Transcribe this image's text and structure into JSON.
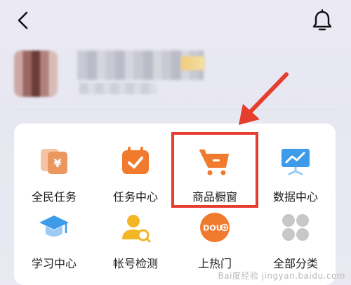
{
  "header": {
    "back_icon": "back-arrow-icon",
    "notification_icon": "bell-icon"
  },
  "profile": {
    "avatar": "blurred-avatar",
    "name": "",
    "subtitle": ""
  },
  "tools": [
    {
      "label": "全民任务",
      "icon": "coin-cards-icon"
    },
    {
      "label": "任务中心",
      "icon": "calendar-check-icon"
    },
    {
      "label": "商品橱窗",
      "icon": "shopping-cart-icon"
    },
    {
      "label": "数据中心",
      "icon": "presentation-chart-icon"
    },
    {
      "label": "学习中心",
      "icon": "graduation-cap-icon"
    },
    {
      "label": "帐号检测",
      "icon": "user-search-icon"
    },
    {
      "label": "上热门",
      "icon": "dou-plus-icon"
    },
    {
      "label": "全部分类",
      "icon": "grid-dots-icon"
    }
  ],
  "annotation": {
    "highlighted_item": "商品橱窗",
    "color": "#e53e2f"
  },
  "watermark": {
    "text": "jingyan.baidu.com",
    "prefix": "Bai度经验"
  },
  "colors": {
    "accent_orange": "#f07b2e",
    "accent_blue": "#3d9be9",
    "grey": "#c7c7c7",
    "annotation_red": "#e53e2f"
  }
}
